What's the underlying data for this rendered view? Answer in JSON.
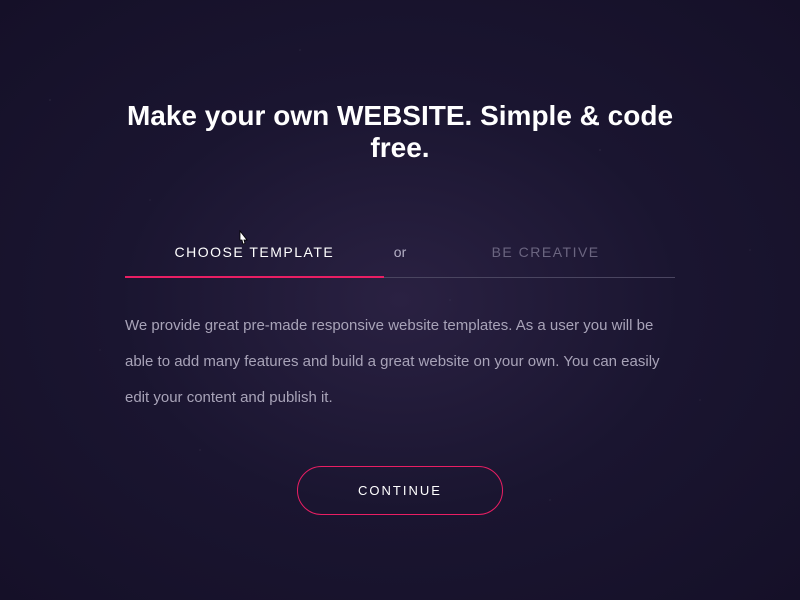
{
  "heading": "Make your own WEBSITE. Simple & code free.",
  "tabs": {
    "left": "CHOOSE TEMPLATE",
    "separator": "or",
    "right": "BE CREATIVE"
  },
  "description": "We provide great pre-made responsive website templates. As a user you will be able to add many features and build a great website on your own. You can easily edit your content and publish it.",
  "button": "CONTINUE",
  "colors": {
    "accent": "#e91e63",
    "background_start": "#2a2142",
    "background_end": "#151028"
  }
}
